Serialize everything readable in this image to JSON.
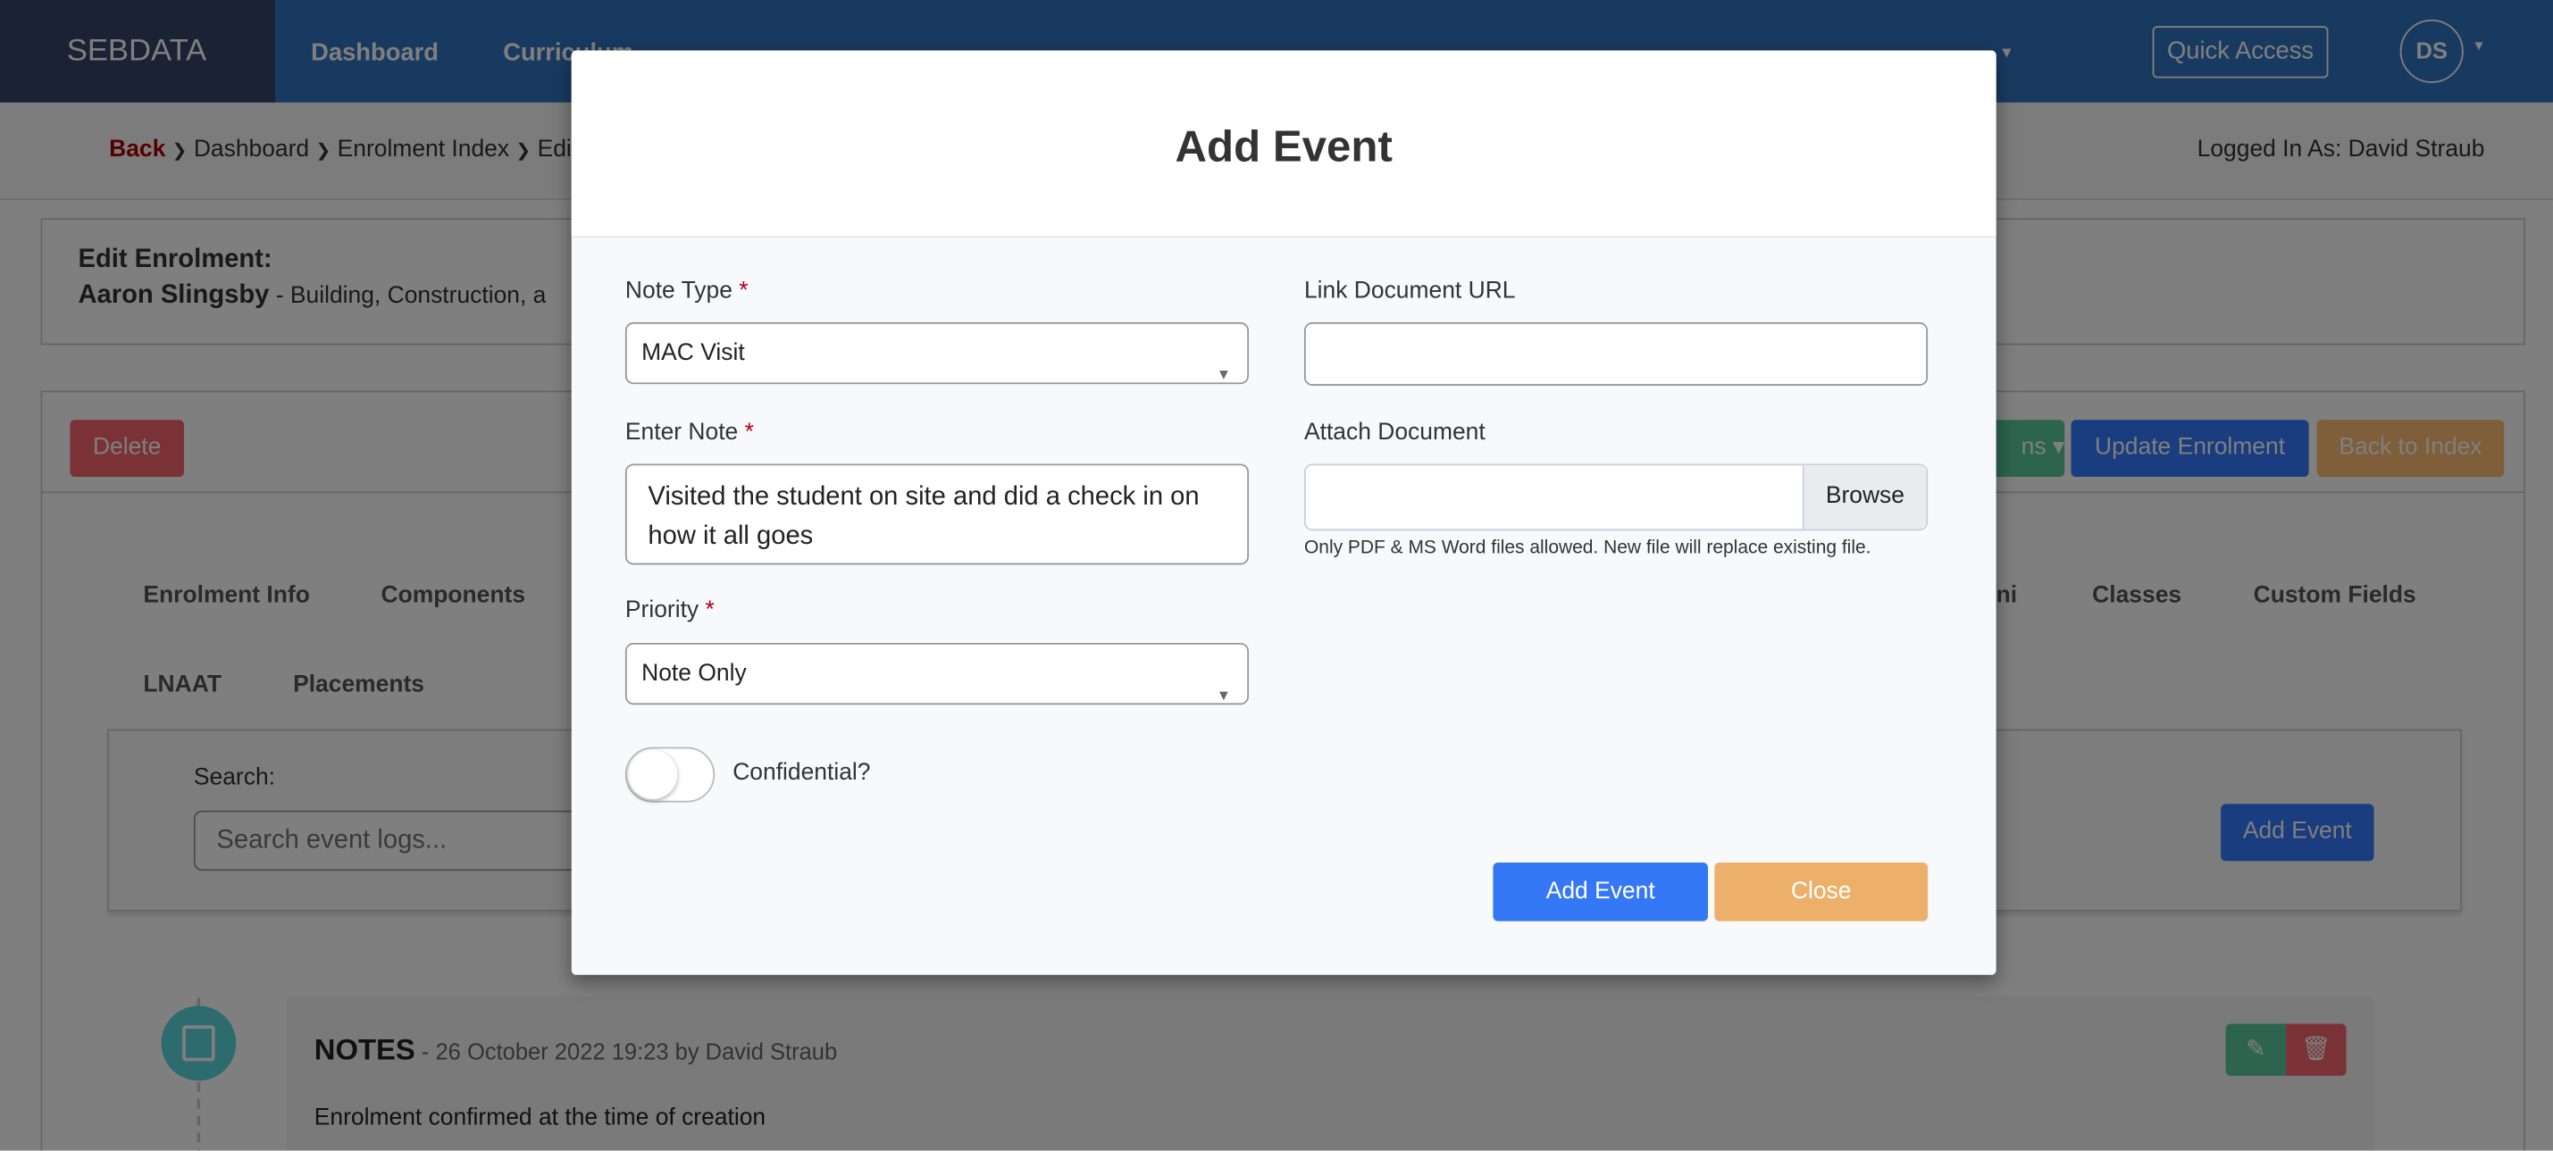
{
  "nav": {
    "brand": "SEBDATA",
    "items": [
      "Dashboard",
      "Curriculum"
    ],
    "quick_access": "Quick Access",
    "avatar": "DS",
    "caret": "▾"
  },
  "breadcrumb": {
    "back": "Back",
    "items": [
      "Dashboard",
      "Enrolment Index",
      "Edit"
    ],
    "sep": "❯",
    "logged_in": "Logged In As: David Straub"
  },
  "enrolment": {
    "heading": "Edit Enrolment:",
    "student": "Aaron Slingsby",
    "course": " - Building, Construction, a"
  },
  "actions": {
    "delete": "Delete",
    "actions_dropdown": "ns ▾",
    "update": "Update Enrolment",
    "back_to_index": "Back to Index"
  },
  "tabs": {
    "row1": [
      "Enrolment Info",
      "Components",
      "ni",
      "Classes",
      "Custom Fields"
    ],
    "row2": [
      "LNAAT",
      "Placements"
    ]
  },
  "events": {
    "search_label": "Search:",
    "search_placeholder": "Search event logs...",
    "add_event": "Add Event",
    "items": [
      {
        "type": "NOTES",
        "meta": "- 26 October 2022 19:23 by David Straub",
        "body": "Enrolment confirmed at the time of creation"
      }
    ]
  },
  "modal": {
    "title": "Add Event",
    "note_type_label": "Note Type",
    "note_type_value": "MAC Visit",
    "link_label": "Link Document URL",
    "link_value": "",
    "note_label": "Enter Note",
    "note_value": "Visited the student on site and did a check in on how it all goes",
    "attach_label": "Attach Document",
    "browse": "Browse",
    "attach_help": "Only PDF & MS Word files allowed. New file will replace existing file.",
    "priority_label": "Priority",
    "priority_value": "Note Only",
    "confidential_label": "Confidential?",
    "confidential_on": false,
    "required_mark": "*",
    "submit": "Add Event",
    "close": "Close"
  },
  "colors": {
    "nav": "#3274c0",
    "primary": "#3478f6",
    "close": "#edb06a",
    "danger": "#dc3545"
  }
}
